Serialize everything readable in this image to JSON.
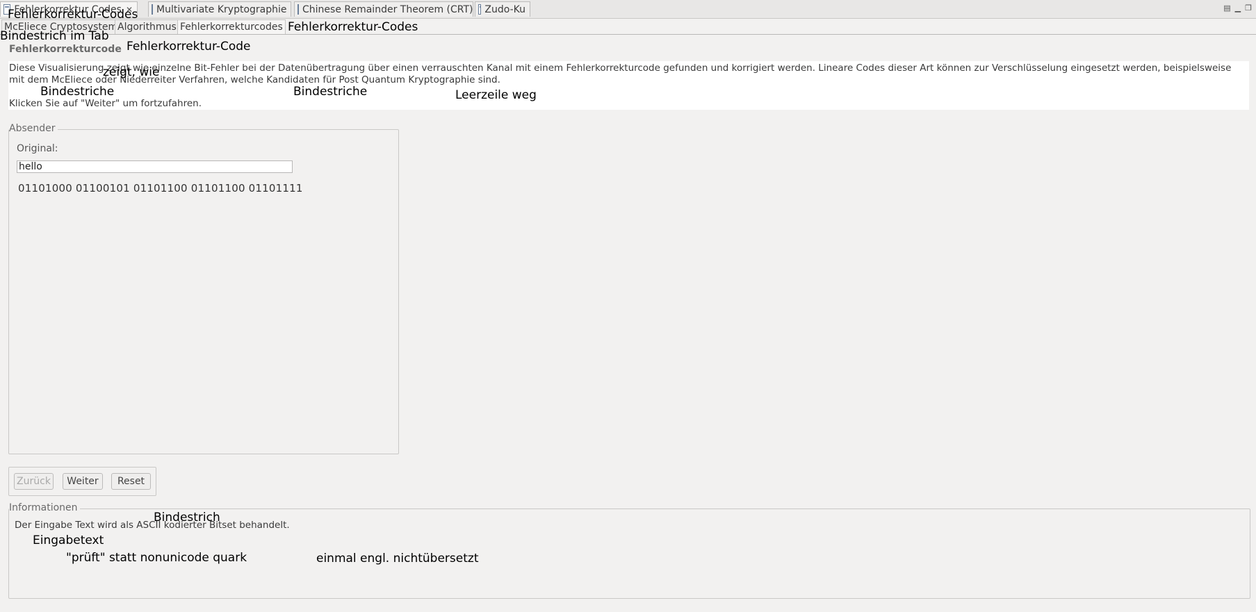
{
  "editor_tabs": [
    {
      "label": "Fehlerkorrektur Codes",
      "active": true,
      "closable": true
    },
    {
      "label": "Multivariate Kryptographie",
      "active": false
    },
    {
      "label": "Chinese Remainder Theorem (CRT)",
      "active": false
    },
    {
      "label": "Zudo-Ku",
      "active": false
    }
  ],
  "window_controls": [
    "view-menu-icon",
    "minimize-icon",
    "maximize-icon"
  ],
  "sub_tabs": [
    {
      "label": "McEliece Cryptosystem",
      "active": false
    },
    {
      "label": "Algorithmus",
      "active": false
    },
    {
      "label": "Fehlerkorrekturcodes",
      "active": true
    }
  ],
  "heading": "Fehlerkorrekturcode",
  "description": {
    "text": "Diese Visualisierung zeigt wie einzelne Bit-Fehler bei der Datenübertragung über einen verrauschten Kanal mit einem Fehlerkorrekturcode gefunden und korrigiert werden. Lineare Codes dieser Art können zur Verschlüsselung eingesetzt werden, beispielsweise mit dem McEliece oder Niederreiter Verfahren, welche Kandidaten für Post Quantum Kryptographie sind.",
    "cta": "Klicken Sie auf \"Weiter\" um fortzufahren."
  },
  "sender": {
    "title": "Absender",
    "original_label": "Original:",
    "input_value": "hello",
    "bits": "01101000 01100101 01101100 01101100 01101111"
  },
  "buttons": {
    "back": "Zurück",
    "next": "Weiter",
    "reset": "Reset"
  },
  "info": {
    "title": "Informationen",
    "text": "Der Eingabe Text wird als ASCII kodierter Bitset behandelt."
  },
  "annotations": {
    "a1": "Fehlerkorrektur-Codes",
    "a2": "Bindestrich im Tab",
    "a3": "Fehlerkorrektur-Code",
    "a4": "Fehlerkorrektur-Codes",
    "a5": "zeigt, wie",
    "a6": "Bindestriche",
    "a7": "Bindestriche",
    "a8": "Leerzeile weg",
    "a9": "Bindestrich",
    "a10": "Eingabetext",
    "a11": "\"prüft\" statt nonunicode quark",
    "a12": "einmal engl. nichtübersetzt"
  }
}
